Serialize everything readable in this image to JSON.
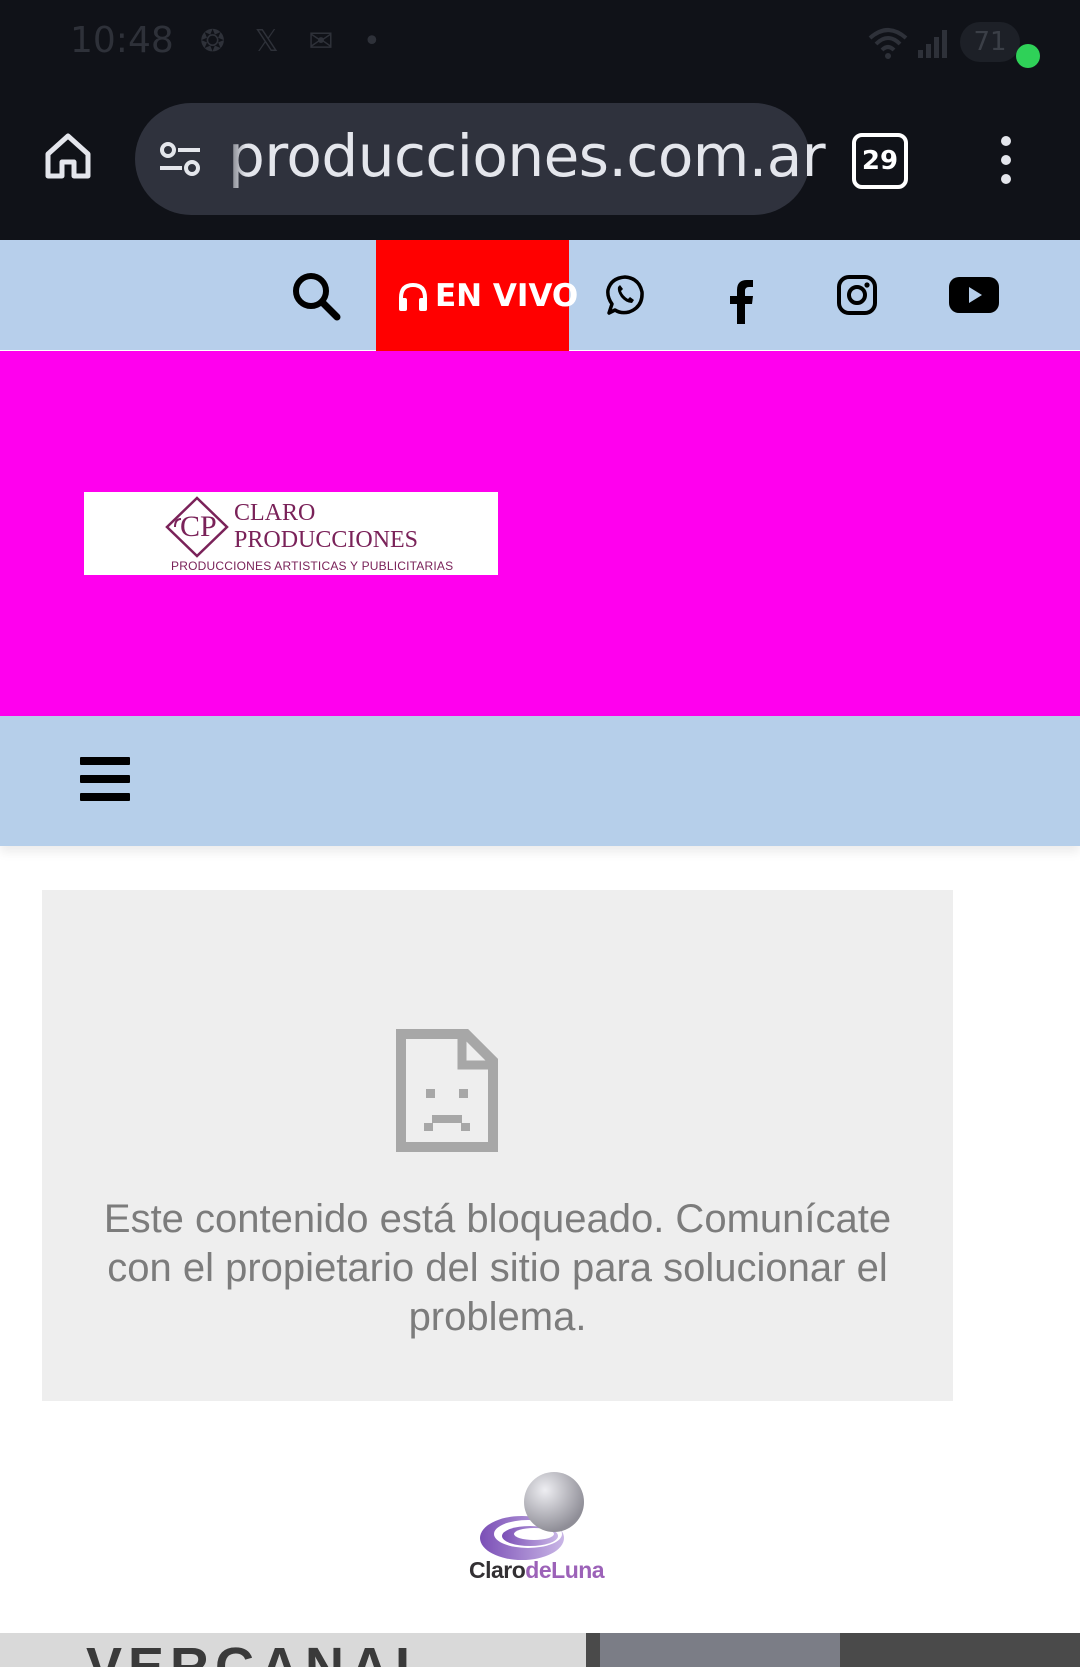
{
  "status_bar": {
    "time": "10:48",
    "notification_icons": "❂ 𝕏 ✉ •",
    "battery": "71"
  },
  "browser": {
    "url": "producciones.com.ar",
    "tab_count": "29"
  },
  "topbar": {
    "live_label": "EN VIVO"
  },
  "logo": {
    "line1": "CLARO",
    "line2": "PRODUCCIONES",
    "line3": "PRODUCCIONES ARTISTICAS Y PUBLICITARIAS",
    "monogram": "CP"
  },
  "blocked": {
    "message": "Este contenido está bloqueado. Comunícate con el propietario del sitio para solucionar el problema."
  },
  "claro_de_luna": {
    "claro": "Claro",
    "de": "de",
    "luna": "Luna"
  },
  "bottom": {
    "text": "VERCANAL"
  },
  "colors": {
    "banner": "#ff00ee",
    "topbar": "#b7cfeb",
    "live": "#ff0000",
    "logo_text": "#7a2259"
  }
}
